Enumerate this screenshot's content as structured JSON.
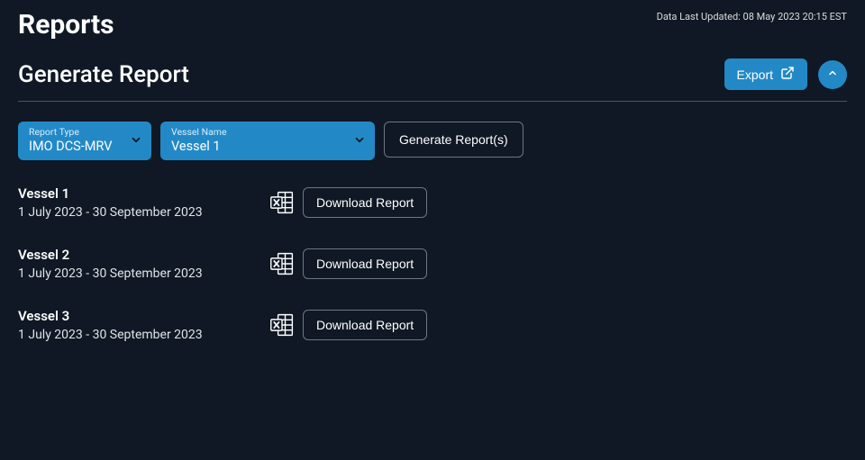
{
  "header": {
    "title": "Reports",
    "last_updated_label": "Data Last Updated: 08 May 2023 20:15 EST"
  },
  "section": {
    "title": "Generate Report",
    "export_label": "Export",
    "filters": {
      "report_type": {
        "label": "Report Type",
        "value": "IMO DCS-MRV"
      },
      "vessel_name": {
        "label": "Vessel Name",
        "value": "Vessel 1"
      }
    },
    "generate_button": "Generate Report(s)",
    "download_label": "Download Report",
    "results": [
      {
        "vessel": "Vessel 1",
        "date_range": "1 July 2023 - 30 September 2023"
      },
      {
        "vessel": "Vessel 2",
        "date_range": "1 July 2023 - 30 September 2023"
      },
      {
        "vessel": "Vessel 3",
        "date_range": "1 July 2023 - 30 September 2023"
      }
    ]
  }
}
